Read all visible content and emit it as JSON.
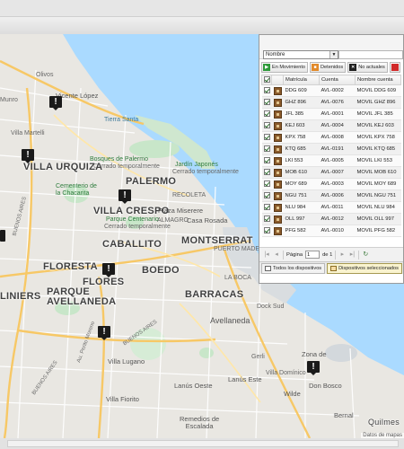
{
  "map": {
    "neighborhoods": {
      "villa_urquiza": "VILLA URQUIZA",
      "palermo": "PALERMO",
      "villa_crespo": "VILLA CRESPO",
      "caballito": "CABALLITO",
      "floresta": "FLORESTA",
      "flores": "FLORES",
      "boedo": "BOEDO",
      "barracas": "BARRACAS",
      "montserrat": "MONTSERRAT",
      "parque_avellaneda": "PARQUE\nAVELLANEDA",
      "liniers": "LINIERS",
      "avellaneda": "Avellaneda",
      "quilmes": "Quilmes"
    },
    "places": {
      "vicente_lopez": "Vicente López",
      "villa_martelli": "Villa Martelli",
      "tierra_santa": "Tierra Santa",
      "bosques": "Bosques de Palermo",
      "bosques_note": "Cerrado temporalmente",
      "jardin": "Jardín Japonés",
      "jardin_note": "Cerrado temporalmente",
      "cementerio": "Cementerio de\nla Chacarita",
      "recoleta": "RECOLETA",
      "almagro": "ALMAGRO",
      "plaza_miserere": "Plaza Miserere",
      "casa_rosada": "Casa Rosada",
      "parque_centenario": "Parque Centenario",
      "parque_centenario_note": "Cerrado temporalmente",
      "puerto_madero": "PUERTO MADERO",
      "la_boca": "LA BOCA",
      "olivos": "Olivos",
      "munro": "Munro",
      "villa_lugano": "Villa Lugano",
      "villa_fiorito": "Villa Fiorito",
      "lanus_oeste": "Lanús Oeste",
      "lanus_este": "Lanús Este",
      "remedios": "Remedios de\nEscalada",
      "wilde": "Wilde",
      "don_bosco": "Don Bosco",
      "zona_de": "Zona de",
      "bernal": "Bernal",
      "gerli": "Gerli",
      "villa_dominico": "Villa Domínico",
      "dock_sud": "Dock Sud"
    },
    "roads": {
      "gral_paz": "Av. Gral. Paz",
      "buenos_aires": "BUENOS AIRES",
      "au_perito": "Au. Perito Moreno"
    },
    "attribution": "Datos de mapas"
  },
  "panel": {
    "select_value": "Nombre",
    "filters": [
      {
        "label": "En Movimiento",
        "color": "#2e9a3a",
        "glyph": "▶"
      },
      {
        "label": "Detenidos",
        "color": "#e28a2a",
        "glyph": "■"
      },
      {
        "label": "No actuales",
        "color": "#1f1f1f",
        "glyph": "✕"
      },
      {
        "label": "",
        "color": "#d12a2a",
        "glyph": ""
      }
    ],
    "columns": [
      "Matrícula",
      "Cuenta",
      "Nombre cuenta"
    ],
    "rows": [
      {
        "plate": "DDG 609",
        "account": "AVL-0002",
        "name": "MOVIL DDG 609"
      },
      {
        "plate": "GHZ 896",
        "account": "AVL-0076",
        "name": "MOVIL GHZ 896"
      },
      {
        "plate": "JFL 385",
        "account": "AVL-0001",
        "name": "MOVIL JFL 385"
      },
      {
        "plate": "KEJ 603",
        "account": "AVL-0004",
        "name": "MOVIL KEJ 603"
      },
      {
        "plate": "KPX 758",
        "account": "AVL-0008",
        "name": "MOVIL KPX 758"
      },
      {
        "plate": "KTQ 685",
        "account": "AVL-0191",
        "name": "MOVIL KTQ 685"
      },
      {
        "plate": "LKI 553",
        "account": "AVL-0005",
        "name": "MOVIL LKI 553"
      },
      {
        "plate": "MOB 610",
        "account": "AVL-0007",
        "name": "MOVIL MOB 610"
      },
      {
        "plate": "MOY 689",
        "account": "AVL-0003",
        "name": "MOVIL MOY 689"
      },
      {
        "plate": "NGU 751",
        "account": "AVL-0006",
        "name": "MOVIL NGU 751"
      },
      {
        "plate": "NLU 984",
        "account": "AVL-0011",
        "name": "MOVIL NLU 984"
      },
      {
        "plate": "OLL 997",
        "account": "AVL-0012",
        "name": "MOVIL OLL 997"
      },
      {
        "plate": "PFG 582",
        "account": "AVL-0010",
        "name": "MOVIL PFG 582"
      }
    ],
    "pager": {
      "label": "Página",
      "page": "1",
      "of": "de 1"
    },
    "tabs": {
      "all": "Todos los dispositivos",
      "selected": "Dispositivos seleccionados"
    }
  },
  "colors": {
    "water": "#aadaff",
    "park": "#c8e6c9",
    "road": "#ffffff",
    "highway": "#fbd78f"
  }
}
